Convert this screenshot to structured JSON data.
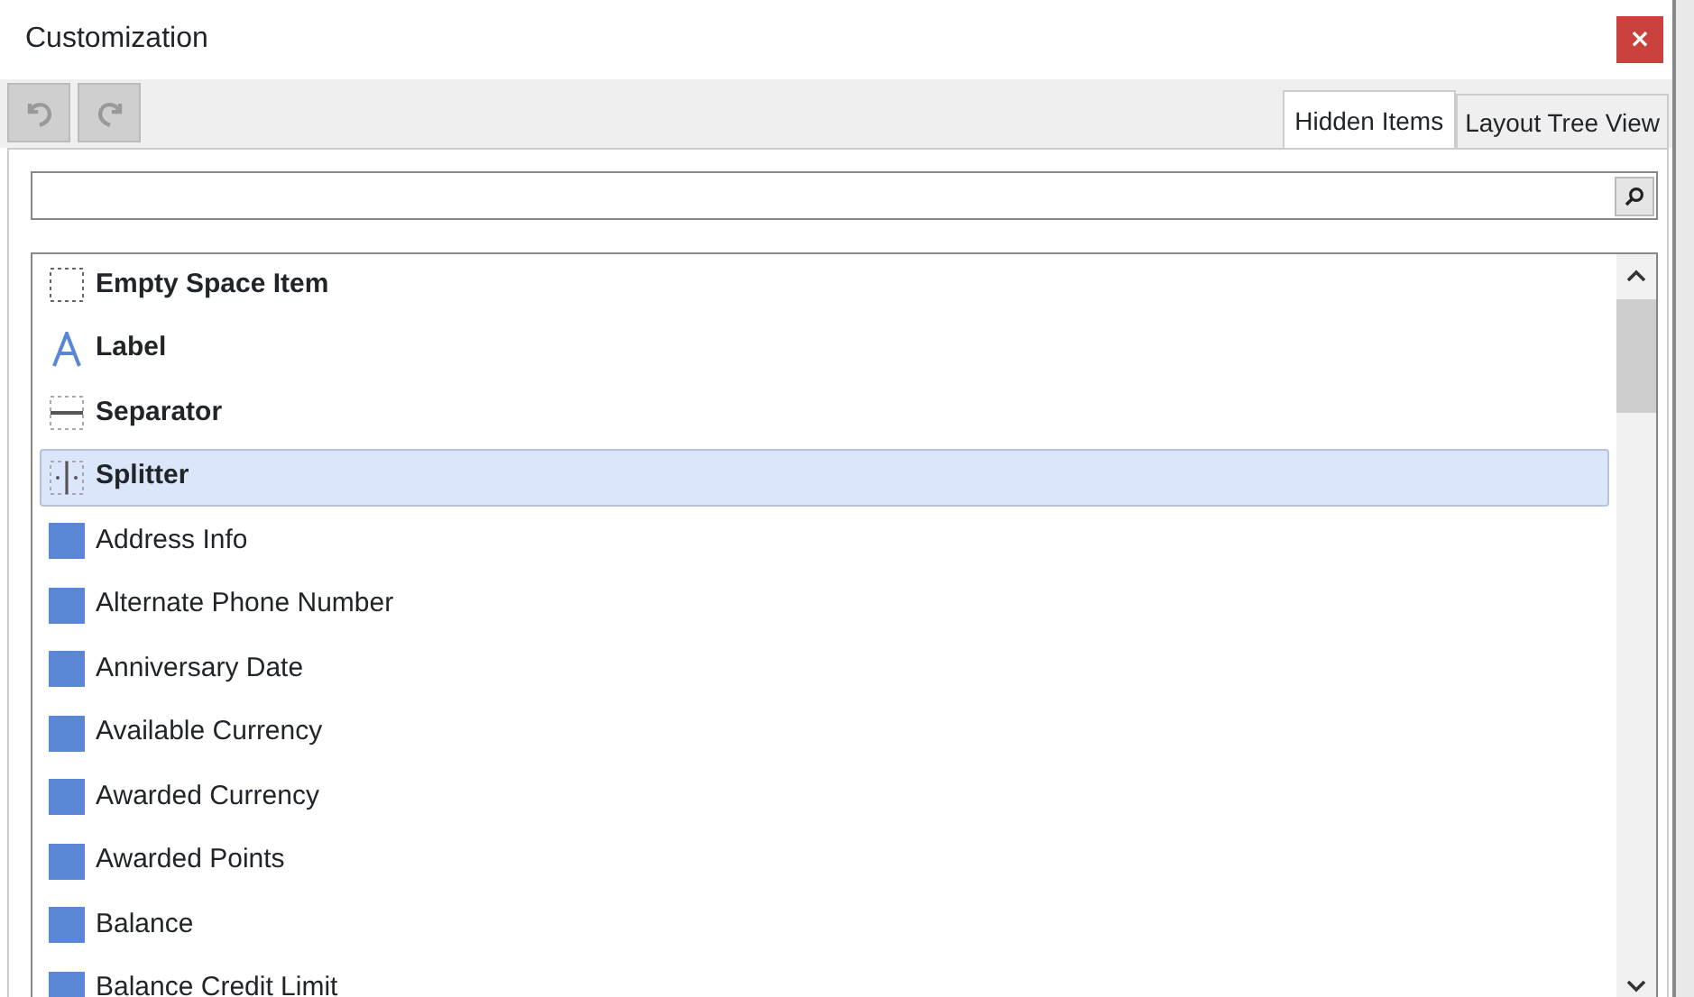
{
  "window": {
    "title": "Customization",
    "close": "×"
  },
  "toolbar": [
    {
      "kind": "undo",
      "disabled": true
    },
    {
      "kind": "redo",
      "disabled": true
    }
  ],
  "tabs": [
    {
      "label": "Hidden Items",
      "selected": true
    },
    {
      "label": "Layout Tree View",
      "selected": false
    }
  ],
  "items": [
    {
      "kind": "empty-space",
      "label": "Empty Space Item",
      "selected": false
    },
    {
      "kind": "label",
      "label": "Label",
      "selected": false
    },
    {
      "kind": "separator",
      "label": "Separator",
      "selected": false
    },
    {
      "kind": "splitter",
      "label": "Splitter",
      "selected": true
    },
    {
      "kind": "field",
      "label": "Address Info",
      "selected": false
    },
    {
      "kind": "field",
      "label": "Alternate Phone Number",
      "selected": false
    },
    {
      "kind": "field",
      "label": "Anniversary Date",
      "selected": false
    },
    {
      "kind": "field",
      "label": "Available Currency",
      "selected": false
    },
    {
      "kind": "field",
      "label": "Awarded Currency",
      "selected": false
    },
    {
      "kind": "field",
      "label": "Awarded Points",
      "selected": false
    },
    {
      "kind": "field",
      "label": "Balance",
      "selected": false
    },
    {
      "kind": "field",
      "label": "Balance Credit Limit",
      "selected": false
    }
  ]
}
